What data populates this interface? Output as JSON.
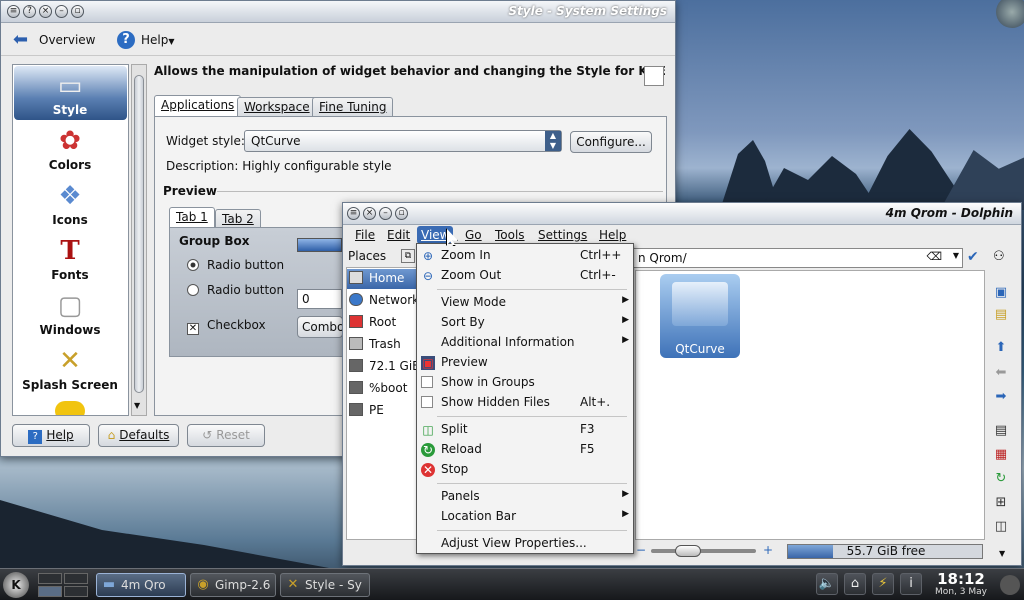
{
  "settings": {
    "title": "Style - System Settings",
    "overview": "Overview",
    "help": "Help",
    "heading": "Allows the manipulation of widget behavior and changing the Style for KDE",
    "categories": [
      "Style",
      "Colors",
      "Icons",
      "Fonts",
      "Windows",
      "Splash Screen"
    ],
    "tabs": [
      "Applications",
      "Workspace",
      "Fine Tuning"
    ],
    "widget_style_label": "Widget style:",
    "widget_style_value": "QtCurve",
    "configure": "Configure...",
    "description": "Description: Highly configurable style",
    "preview": "Preview",
    "preview_tabs": [
      "Tab 1",
      "Tab 2"
    ],
    "group_box": "Group Box",
    "radio1": "Radio button",
    "radio2": "Radio button",
    "spin_value": "0",
    "checkbox": "Checkbox",
    "combo": "Combo",
    "help_btn": "Help",
    "defaults_btn": "Defaults",
    "reset_btn": "Reset"
  },
  "dolphin": {
    "title": "4m Qrom - Dolphin",
    "menubar": [
      "File",
      "Edit",
      "View",
      "Go",
      "Tools",
      "Settings",
      "Help"
    ],
    "places_title": "Places",
    "places": [
      "Home",
      "Network",
      "Root",
      "Trash",
      "72.1 GiB",
      "%boot",
      "PE"
    ],
    "location": "n Qrom/",
    "folder": "QtCurve",
    "free": "55.7 GiB free",
    "free_fraction": 0.23
  },
  "view_menu": [
    {
      "label": "Zoom In",
      "shortcut": "Ctrl++",
      "icon": "zoom-in-icon"
    },
    {
      "label": "Zoom Out",
      "shortcut": "Ctrl+-",
      "icon": "zoom-out-icon"
    },
    {
      "label": "View Mode",
      "submenu": true
    },
    {
      "label": "Sort By",
      "submenu": true
    },
    {
      "label": "Additional Information",
      "submenu": true
    },
    {
      "label": "Preview",
      "icon": "preview-icon"
    },
    {
      "label": "Show in Groups",
      "check": true
    },
    {
      "label": "Show Hidden Files",
      "shortcut": "Alt+.",
      "check": true
    },
    {
      "label": "Split",
      "shortcut": "F3",
      "icon": "split-icon"
    },
    {
      "label": "Reload",
      "shortcut": "F5",
      "icon": "reload-icon"
    },
    {
      "label": "Stop",
      "icon": "stop-icon"
    },
    {
      "label": "Panels",
      "submenu": true
    },
    {
      "label": "Location Bar",
      "submenu": true
    },
    {
      "label": "Adjust View Properties..."
    }
  ],
  "taskbar": {
    "tasks": [
      "4m Qro",
      "Gimp-2.6",
      "Style - Sy"
    ],
    "time": "18:12",
    "date": "Mon, 3 May"
  }
}
